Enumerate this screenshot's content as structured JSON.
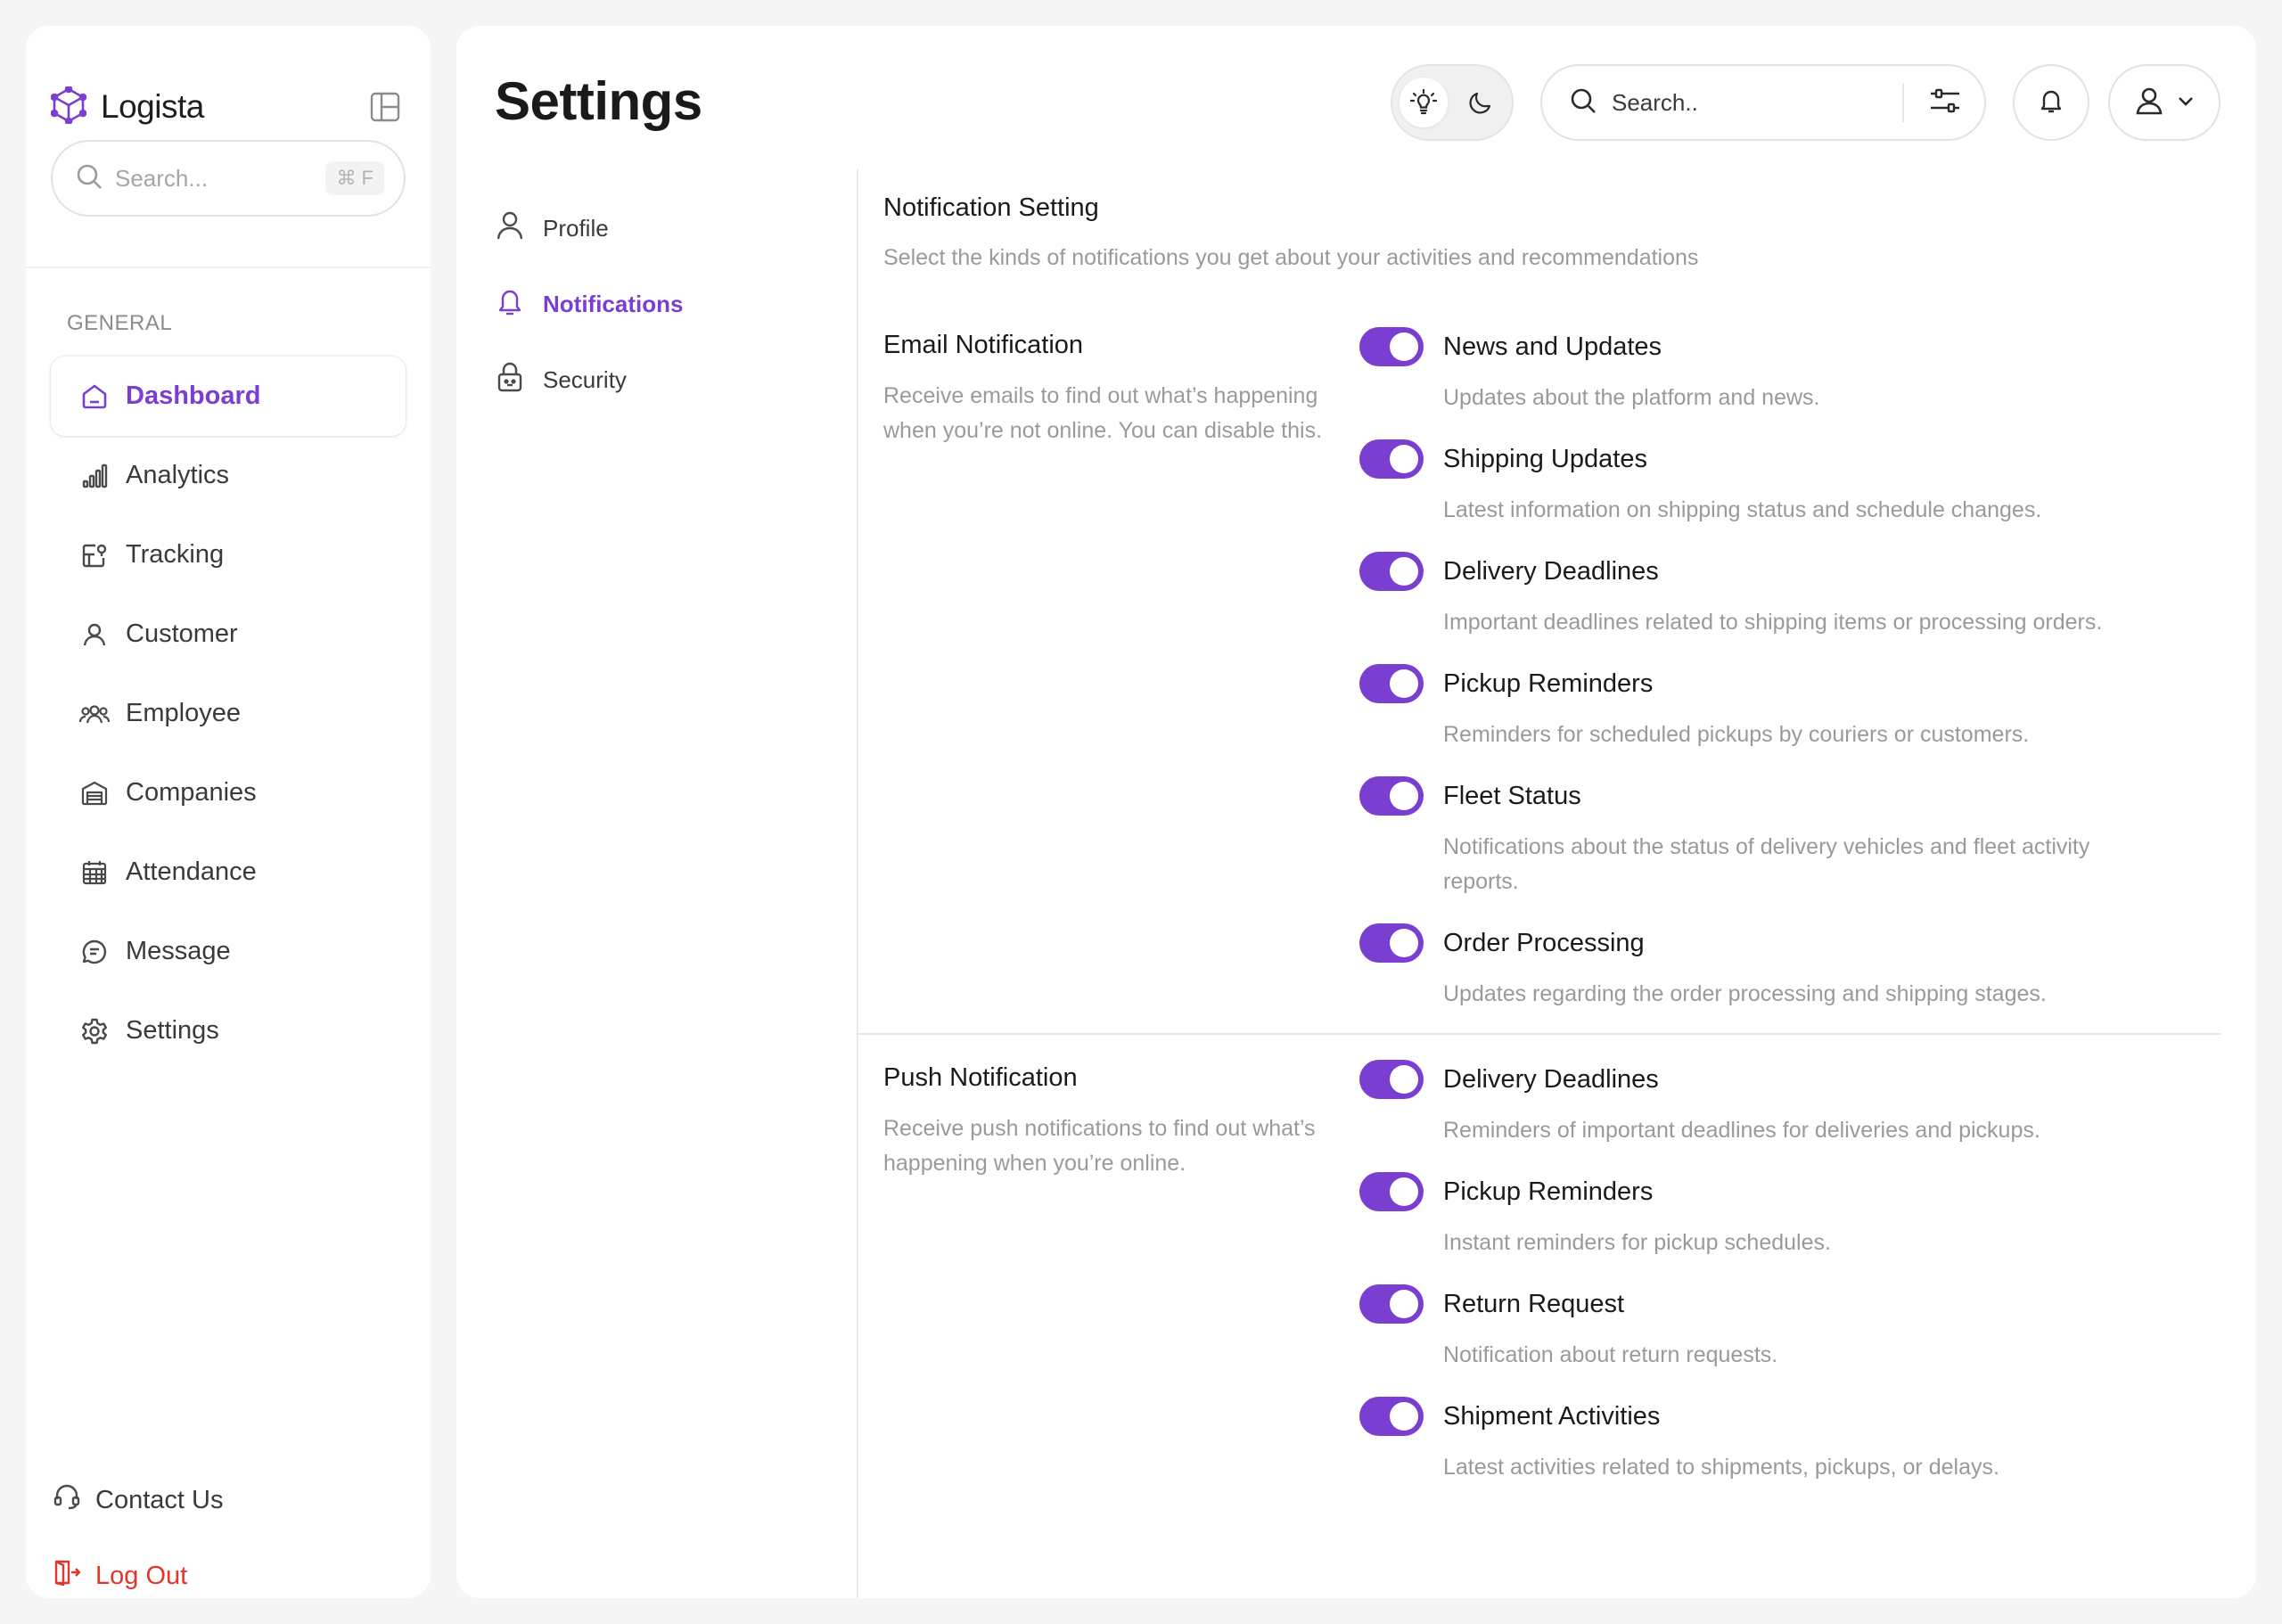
{
  "brand": {
    "name": "Logista",
    "accent": "#7a3fd0"
  },
  "sidebar": {
    "search_placeholder": "Search...",
    "search_shortcut": "⌘ F",
    "section_label": "GENERAL",
    "items": [
      {
        "label": "Dashboard",
        "icon": "home-icon",
        "active": true
      },
      {
        "label": "Analytics",
        "icon": "analytics-icon"
      },
      {
        "label": "Tracking",
        "icon": "tracking-icon"
      },
      {
        "label": "Customer",
        "icon": "user-icon"
      },
      {
        "label": "Employee",
        "icon": "users-icon"
      },
      {
        "label": "Companies",
        "icon": "warehouse-icon"
      },
      {
        "label": "Attendance",
        "icon": "calendar-icon"
      },
      {
        "label": "Message",
        "icon": "message-icon"
      },
      {
        "label": "Settings",
        "icon": "gear-icon"
      }
    ],
    "contact_label": "Contact Us",
    "logout_label": "Log Out",
    "logout_color": "#e5352b"
  },
  "header": {
    "title": "Settings",
    "search_placeholder": "Search.."
  },
  "settings_nav": [
    {
      "label": "Profile",
      "icon": "user-icon"
    },
    {
      "label": "Notifications",
      "icon": "bell-icon",
      "active": true
    },
    {
      "label": "Security",
      "icon": "lock-icon"
    }
  ],
  "notification_setting": {
    "title": "Notification Setting",
    "subtitle": "Select the kinds of notifications you get about your activities and recommendations"
  },
  "email": {
    "title": "Email Notification",
    "desc_line1": "Receive emails to find out what’s happening",
    "desc_line2": "when you’re not online. You can disable this.",
    "items": [
      {
        "label": "News and Updates",
        "desc": "Updates about the platform and news.",
        "enabled": true
      },
      {
        "label": "Shipping Updates",
        "desc": "Latest information on shipping status and schedule changes.",
        "enabled": true
      },
      {
        "label": "Delivery Deadlines",
        "desc": "Important deadlines related to shipping items or processing orders.",
        "enabled": true
      },
      {
        "label": "Pickup Reminders",
        "desc": "Reminders for scheduled pickups by couriers or customers.",
        "enabled": true
      },
      {
        "label": "Fleet Status",
        "desc_line1": "Notifications about the status of delivery vehicles and fleet activity",
        "desc_line2": "reports.",
        "enabled": true
      },
      {
        "label": "Order Processing",
        "desc": "Updates regarding the order processing and shipping stages.",
        "enabled": true
      }
    ]
  },
  "push": {
    "title": "Push Notification",
    "desc_line1": "Receive push notifications to find out what’s",
    "desc_line2": "happening when you’re online.",
    "items": [
      {
        "label": "Delivery Deadlines",
        "desc": "Reminders of important deadlines for deliveries and pickups.",
        "enabled": true
      },
      {
        "label": "Pickup Reminders",
        "desc": "Instant reminders for pickup schedules.",
        "enabled": true
      },
      {
        "label": "Return Request",
        "desc": "Notification about return requests.",
        "enabled": true
      },
      {
        "label": "Shipment Activities",
        "desc": "Latest activities related to shipments, pickups, or delays.",
        "enabled": true
      }
    ]
  }
}
